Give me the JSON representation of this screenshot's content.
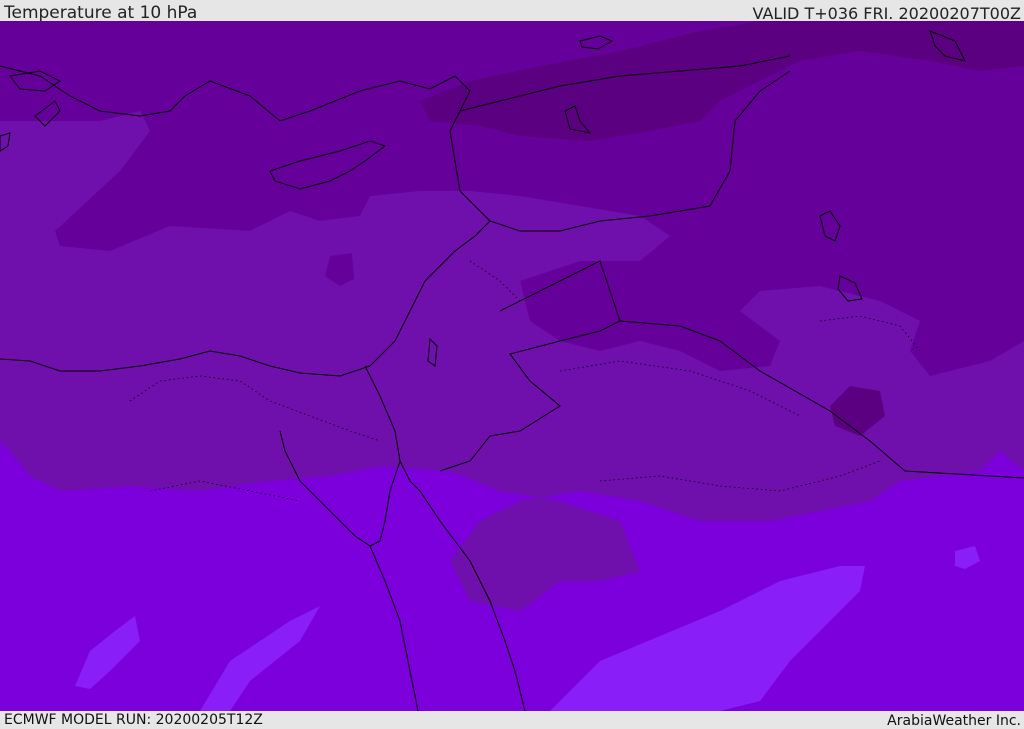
{
  "header": {
    "title": "Temperature at 10 hPa",
    "valid": "VALID T+036 FRI. 20200207T00Z"
  },
  "footer": {
    "model_run": "ECMWF MODEL RUN: 20200205T12Z",
    "brand": "ArabiaWeather Inc."
  },
  "map": {
    "colors": {
      "band_darkest": "#5c0082",
      "band_dark": "#66009a",
      "band_mid": "#7010ac",
      "band_light": "#7b00dc",
      "band_bright": "#8a1ef8",
      "coast": "#000000"
    }
  }
}
